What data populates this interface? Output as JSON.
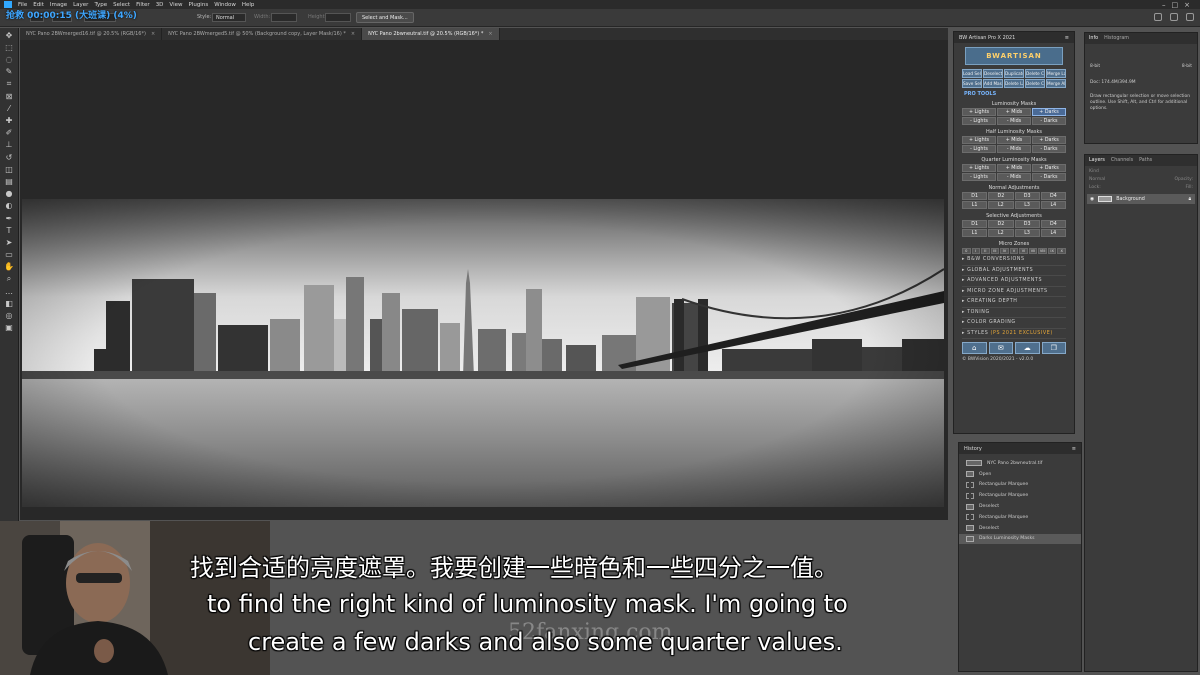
{
  "overlay_timer": "抢救 00:00:15 (大班课) (4%)",
  "menubar": {
    "items": [
      "File",
      "Edit",
      "Image",
      "Layer",
      "Type",
      "Select",
      "Filter",
      "3D",
      "View",
      "Plugins",
      "Window",
      "Help"
    ]
  },
  "options": {
    "style_label": "Style:",
    "style_value": "Normal",
    "width_label": "Width:",
    "height_label": "Height:",
    "select_mask_button": "Select and Mask..."
  },
  "tabs": [
    {
      "label": "NYC Pano 2BWmerged16.tif @ 20.5% (RGB/16*)",
      "active": false
    },
    {
      "label": "NYC Pano 2BWmerged5.tif @ 50% (Background copy, Layer Mask/16) *",
      "active": false
    },
    {
      "label": "NYC Pano 2bwneutral.tif @ 20.5% (RGB/16*) *",
      "active": true
    }
  ],
  "artisan": {
    "title": "BW Artisan Pro X 2021",
    "logo": "BWARTISAN",
    "top_buttons": [
      "Load Selection",
      "Deselect Selection",
      "Duplicate Layer",
      "Delete Channel",
      "Merge Layers",
      "Save Selection",
      "Add Mask",
      "Delete Layer",
      "Delete Channels",
      "Merge All"
    ],
    "pro_tools": "PRO TOOLS",
    "lum_title": "Luminosity Masks",
    "lum_row1": [
      "+ Lights",
      "+ Mids",
      "+ Darks"
    ],
    "lum_row2": [
      "- Lights",
      "- Mids",
      "- Darks"
    ],
    "half_title": "Half Luminosity Masks",
    "half_row1": [
      "+ Lights",
      "+ Mids",
      "+ Darks"
    ],
    "half_row2": [
      "- Lights",
      "- Mids",
      "- Darks"
    ],
    "quarter_title": "Quarter Luminosity Masks",
    "quarter_row1": [
      "+ Lights",
      "+ Mids",
      "+ Darks"
    ],
    "quarter_row2": [
      "- Lights",
      "- Mids",
      "- Darks"
    ],
    "normal_title": "Normal Adjustments",
    "normal_d": [
      "D1",
      "D2",
      "D3",
      "D4"
    ],
    "normal_l": [
      "L1",
      "L2",
      "L3",
      "L4"
    ],
    "selective_title": "Selective Adjustments",
    "selective_d": [
      "D1",
      "D2",
      "D3",
      "D4"
    ],
    "selective_l": [
      "L1",
      "L2",
      "L3",
      "L4"
    ],
    "micro_title": "Micro Zones",
    "micro_zones": [
      "0",
      "I",
      "II",
      "III",
      "IV",
      "V",
      "VI",
      "VII",
      "VIII",
      "IX",
      "X"
    ],
    "expanders": [
      "B&W CONVERSIONS",
      "GLOBAL ADJUSTMENTS",
      "ADVANCED ADJUSTMENTS",
      "MICRO ZONE ADJUSTMENTS",
      "CREATING DEPTH",
      "TONING",
      "COLOR GRADING",
      "STYLES"
    ],
    "styles_tag": "(PS 2021 EXCLUSIVE)",
    "footer_icons": [
      "⌂",
      "✉",
      "☁",
      "❐"
    ],
    "credit": "© BWVision 2020/2021 - v2.0.0"
  },
  "history": {
    "title": "History",
    "snapshot": "NYC Pano 2bwneutral.tif",
    "items": [
      "Open",
      "Rectangular Marquee",
      "Rectangular Marquee",
      "Deselect",
      "Rectangular Marquee",
      "Deselect",
      "Darks Luminosity Masks"
    ],
    "selected_index": 6
  },
  "info": {
    "tabs": [
      "Info",
      "Histogram"
    ],
    "doc": "Doc: 174.4M/394.9M",
    "hint": "Draw rectangular selection or move selection outline. Use Shift, Alt, and Ctrl for additional options.",
    "bits_left": "8-bit",
    "bits_right": "8-bit"
  },
  "layers": {
    "tabs": [
      "Layers",
      "Channels",
      "Paths"
    ],
    "kind_placeholder": "Kind",
    "blend": "Normal",
    "opacity_label": "Opacity:",
    "lock_label": "Lock:",
    "fill_label": "Fill:",
    "layer_name": "Background"
  },
  "subtitles": {
    "zh": "找到合适的亮度遮罩。我要创建一些暗色和一些四分之一值。",
    "en1": "to find the right kind of luminosity mask. I'm going to",
    "en2": "create a few darks and also some quarter values."
  },
  "watermark": "52fanxing.com",
  "colors": {
    "accent_blue": "#31a8ff",
    "artisan_button": "#4f6f8d",
    "styles_tag": "#e8a838"
  }
}
